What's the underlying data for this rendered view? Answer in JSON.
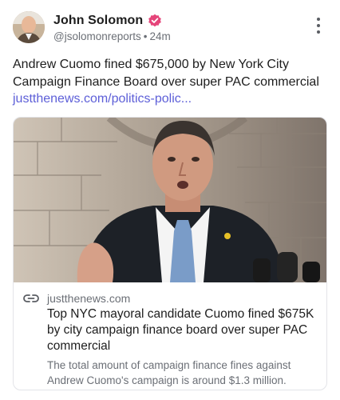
{
  "author": {
    "name": "John Solomon",
    "handle": "@jsolomonreports",
    "time": "24m",
    "separator": "•"
  },
  "post": {
    "text_lines": [
      "Andrew Cuomo fined $675,000 by New York City",
      "Campaign Finance Board over super PAC commercial"
    ],
    "link_text": "justthenews.com/politics-polic..."
  },
  "link_card": {
    "domain": "justthenews.com",
    "title_lines": [
      "Top NYC mayoral candidate Cuomo fined $675K",
      "by city campaign finance board over super PAC",
      "commercial"
    ],
    "description_lines": [
      "The total amount of campaign finance fines against",
      "Andrew Cuomo's campaign is around $1.3 million."
    ]
  },
  "icons": {
    "verified": "verified-badge-icon",
    "more": "more-vertical-icon",
    "link": "link-icon"
  },
  "colors": {
    "link": "#5d5fd8",
    "verified": "#e5457a",
    "muted": "#6b6f76"
  }
}
